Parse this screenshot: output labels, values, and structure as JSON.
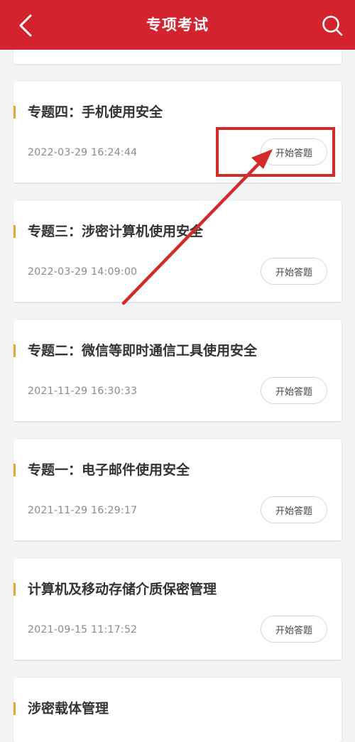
{
  "header": {
    "title": "专项考试",
    "back_icon": "chevron-left-icon",
    "search_icon": "search-icon",
    "bg_color": "#d3232f"
  },
  "exams": [
    {
      "title": "专题四：手机使用安全",
      "date": "2022-03-29 16:24:44",
      "button": "开始答题"
    },
    {
      "title": "专题三：涉密计算机使用安全",
      "date": "2022-03-29 14:09:00",
      "button": "开始答题"
    },
    {
      "title": "专题二：微信等即时通信工具使用安全",
      "date": "2021-11-29 16:30:33",
      "button": "开始答题"
    },
    {
      "title": "专题一：电子邮件使用安全",
      "date": "2021-11-29 16:29:17",
      "button": "开始答题"
    },
    {
      "title": "计算机及移动存储介质保密管理",
      "date": "2021-09-15 11:17:52",
      "button": "开始答题"
    },
    {
      "title": "涉密载体管理",
      "date": "",
      "button": ""
    }
  ],
  "annotation": {
    "color": "#d32a2a"
  },
  "accent_bar_color": "#e8a33a"
}
